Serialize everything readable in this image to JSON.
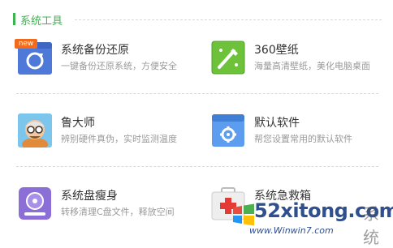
{
  "section": {
    "title": "系统工具"
  },
  "tools": [
    {
      "name": "系统备份还原",
      "desc": "一键备份还原系统，方便安全",
      "icon": "backup-restore-icon",
      "badge": "new"
    },
    {
      "name": "360壁纸",
      "desc": "海量高清壁纸，美化电脑桌面",
      "icon": "wallpaper-icon"
    },
    {
      "name": "鲁大师",
      "desc": "辨别硬件真伪，实时监测温度",
      "icon": "ludashi-icon"
    },
    {
      "name": "默认软件",
      "desc": "帮您设置常用的默认软件",
      "icon": "default-software-icon"
    },
    {
      "name": "系统盘瘦身",
      "desc": "转移清理C盘文件，释放空间",
      "icon": "disk-slim-icon"
    },
    {
      "name": "系统急救箱",
      "desc": "",
      "icon": "first-aid-kit-icon"
    }
  ],
  "watermark": {
    "brand": "52xitong.com",
    "cn_text": "系统",
    "url": "www.Winwin7.com"
  },
  "colors": {
    "accent_green": "#3fb34f",
    "text_dark": "#333333",
    "text_gray": "#999999"
  }
}
